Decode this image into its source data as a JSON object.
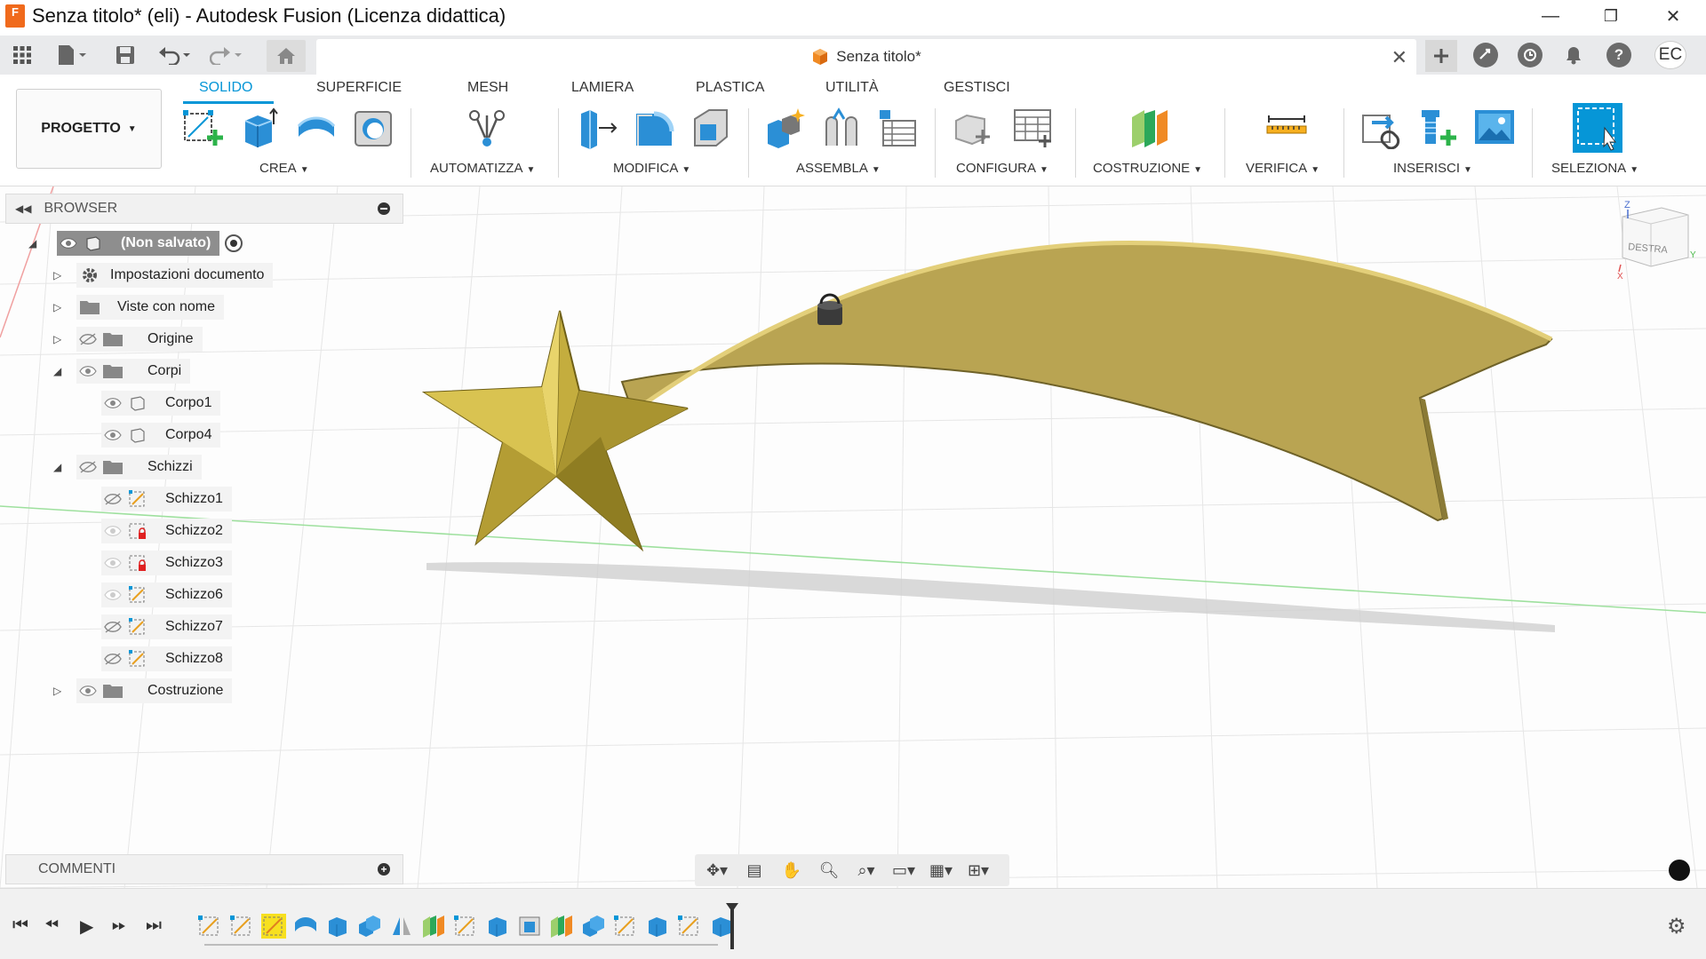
{
  "window": {
    "title": "Senza titolo* (eli) - Autodesk Fusion (Licenza didattica)",
    "logo_letter": "F",
    "minimize": "—",
    "maximize": "❐",
    "close": "✕"
  },
  "document_tab": {
    "title": "Senza titolo*",
    "close": "✕"
  },
  "user": {
    "initials": "EC"
  },
  "ribbon": {
    "workspace": "PROGETTO",
    "tabs": [
      "SOLIDO",
      "SUPERFICIE",
      "MESH",
      "LAMIERA",
      "PLASTICA",
      "UTILITÀ",
      "GESTISCI"
    ],
    "active_tab": "SOLIDO",
    "groups": [
      "CREA",
      "AUTOMATIZZA",
      "MODIFICA",
      "ASSEMBLA",
      "CONFIGURA",
      "COSTRUZIONE",
      "VERIFICA",
      "INSERISCI",
      "SELEZIONA"
    ]
  },
  "browser": {
    "title": "BROWSER",
    "root": "(Non salvato)",
    "items": [
      {
        "label": "Impostazioni documento"
      },
      {
        "label": "Viste con nome"
      },
      {
        "label": "Origine"
      },
      {
        "label": "Corpi"
      },
      {
        "label": "Corpo1"
      },
      {
        "label": "Corpo4"
      },
      {
        "label": "Schizzi"
      },
      {
        "label": "Schizzo1"
      },
      {
        "label": "Schizzo2"
      },
      {
        "label": "Schizzo3"
      },
      {
        "label": "Schizzo6"
      },
      {
        "label": "Schizzo7"
      },
      {
        "label": "Schizzo8"
      },
      {
        "label": "Costruzione"
      }
    ]
  },
  "comments": {
    "title": "COMMENTI"
  },
  "viewcube": {
    "face": "DESTRA",
    "axis_z": "Z",
    "axis_y": "Y",
    "axis_x": "X"
  },
  "colors": {
    "accent": "#0696d7",
    "body_gold": "#b9a452",
    "panel": "#f1f1f1"
  }
}
